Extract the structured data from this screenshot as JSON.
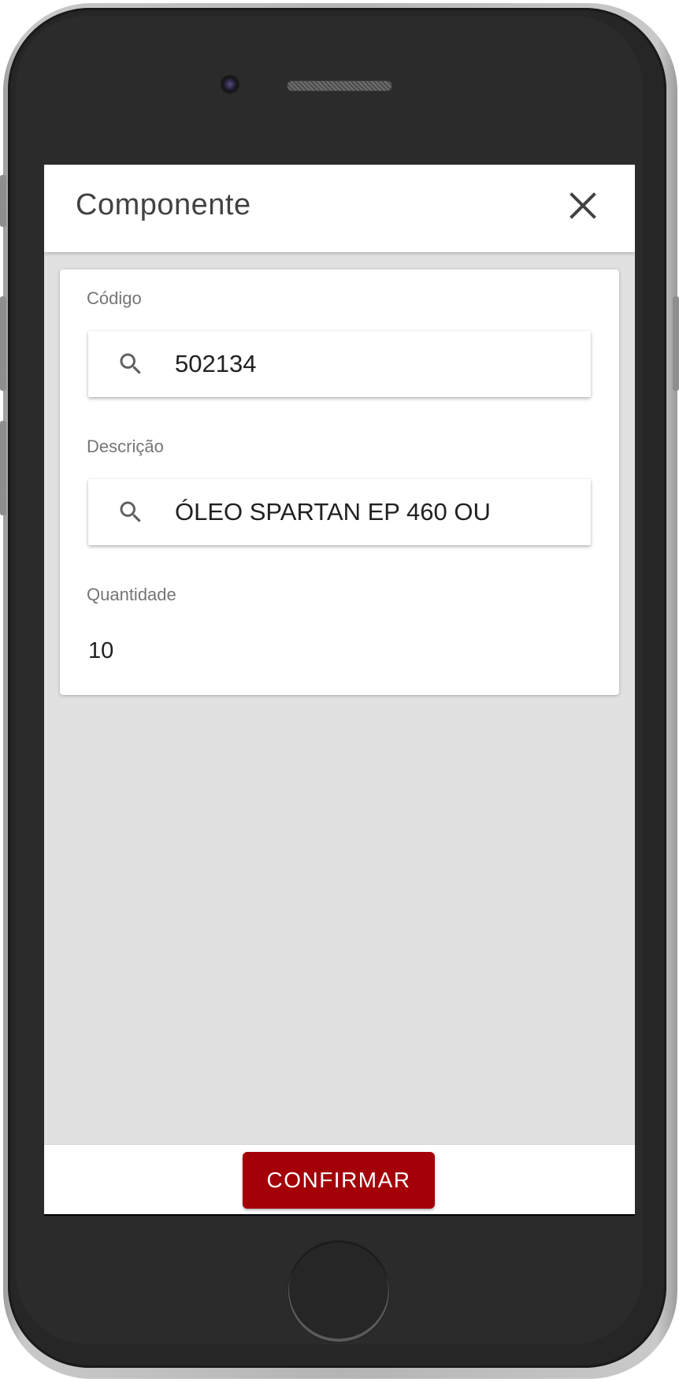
{
  "header": {
    "title": "Componente",
    "close_icon": "close-icon"
  },
  "form": {
    "codigo": {
      "label": "Código",
      "value": "502134",
      "icon": "search-icon"
    },
    "descricao": {
      "label": "Descrição",
      "value": "ÓLEO SPARTAN EP 460 OU",
      "icon": "search-icon"
    },
    "quantidade": {
      "label": "Quantidade",
      "value": "10"
    }
  },
  "footer": {
    "confirm_label": "CONFIRMAR"
  },
  "colors": {
    "accent": "#a30008",
    "background": "#e1e1e1",
    "surface": "#ffffff",
    "label": "#757575",
    "text": "#212121"
  }
}
